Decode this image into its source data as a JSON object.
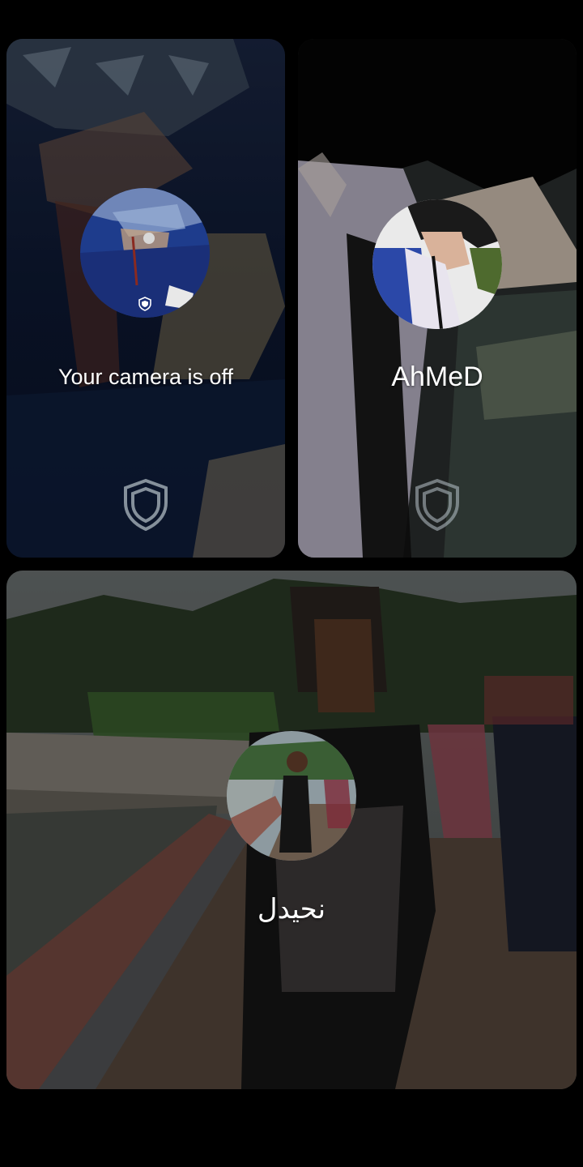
{
  "tiles": {
    "self": {
      "status_text": "Your camera is off",
      "icon": "shield-icon"
    },
    "ahmed": {
      "name": "AhMeD",
      "icon": "shield-icon"
    },
    "third": {
      "name": "نحيدل"
    }
  },
  "colors": {
    "background": "#000000",
    "label": "#ffffff",
    "shield_outline": "#b9c4cc"
  }
}
